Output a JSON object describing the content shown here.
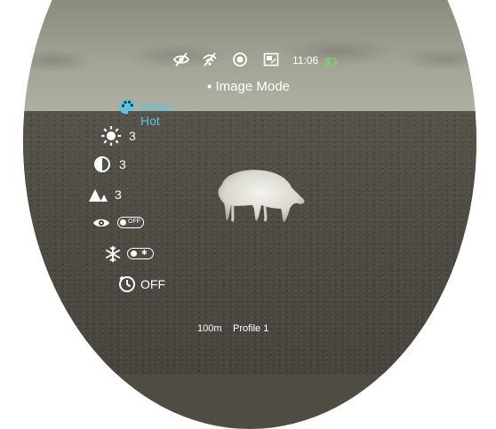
{
  "status_bar": {
    "time": "11:06",
    "icons": [
      "eye-hidden-icon",
      "wifi-off-icon",
      "stabilization-icon",
      "pip-icon",
      "battery-icon"
    ]
  },
  "menu": {
    "title": "Image Mode",
    "items": [
      {
        "icon": "palette-icon",
        "label": "White Hot",
        "selected": true
      },
      {
        "icon": "brightness-icon",
        "label": "3"
      },
      {
        "icon": "contrast-icon",
        "label": "3"
      },
      {
        "icon": "sharpness-icon",
        "label": "3"
      },
      {
        "icon": "eye-icon",
        "toggle": "OFF"
      },
      {
        "icon": "snowflake-icon",
        "toggle": "ON"
      },
      {
        "icon": "clock-icon",
        "label": "OFF"
      }
    ]
  },
  "footer": {
    "range": "100m",
    "profile": "Profile 1"
  },
  "colors": {
    "accent": "#5ec2e0",
    "text": "#ffffff",
    "battery": "#7dd36b"
  }
}
